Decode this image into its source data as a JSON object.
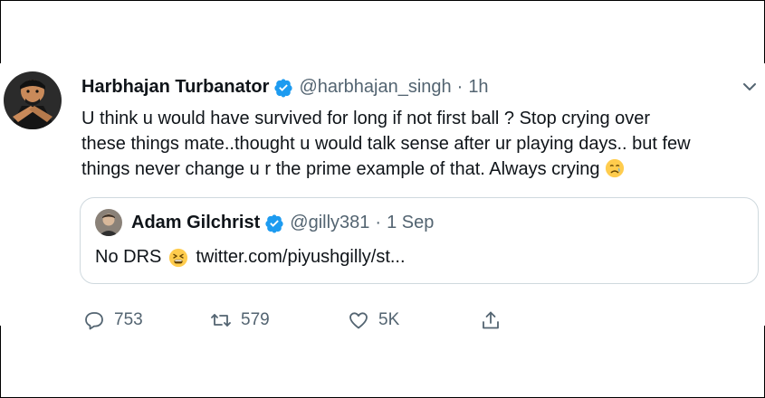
{
  "tweet": {
    "author": {
      "name": "Harbhajan Turbanator",
      "handle": "@harbhajan_singh",
      "verified": true,
      "avatar_icon": "avatar-harbhajan"
    },
    "separator": "·",
    "time": "1h",
    "text": "U think u would have survived for long if not first ball ? Stop crying over\nthese things mate..thought u would talk sense after ur playing days.. but few\nthings never change  u r the prime example of that. Always crying",
    "text_emoji": "crying-face-emoji",
    "quoted": {
      "author": {
        "name": "Adam Gilchrist",
        "handle": "@gilly381",
        "verified": true,
        "avatar_icon": "avatar-gilchrist"
      },
      "separator": "·",
      "date": "1 Sep",
      "text_prefix": "No DRS",
      "text_emoji": "tired-face-emoji",
      "link": "twitter.com/piyushgilly/st..."
    },
    "actions": {
      "replies": "753",
      "retweets": "579",
      "likes": "5K"
    },
    "colors": {
      "verified_badge": "#1d9bf0",
      "secondary_text": "#536471",
      "quote_border": "#cfd9de"
    }
  }
}
